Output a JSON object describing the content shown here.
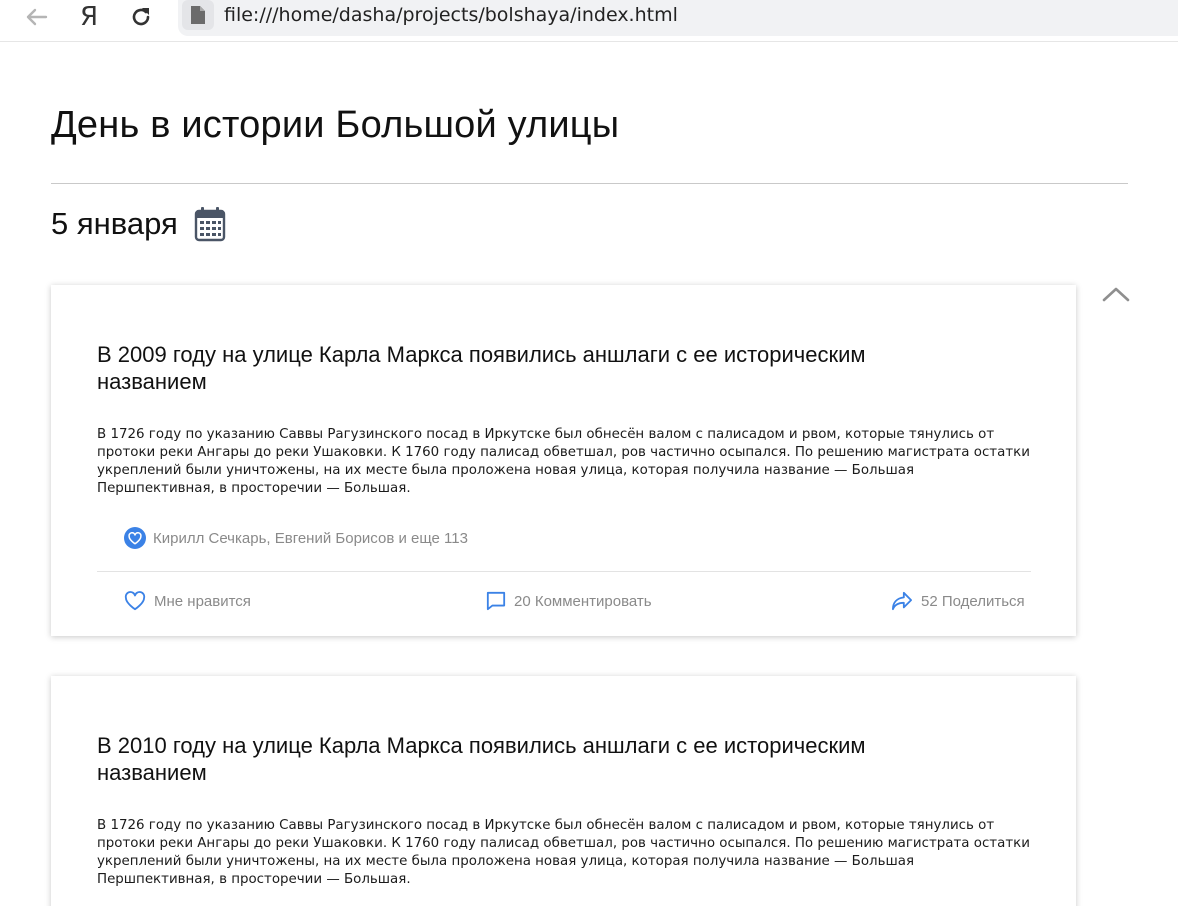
{
  "browser": {
    "back_icon": "arrow-left-icon",
    "yandex_logo": "Я",
    "reload_icon": "reload-icon",
    "file_icon": "file-icon",
    "url": "file:///home/dasha/projects/bolshaya/index.html"
  },
  "page": {
    "title": "День в истории Большой улицы",
    "date": "5 января",
    "calendar_icon": "calendar-icon",
    "collapse_icon": "chevron-up-icon"
  },
  "posts": [
    {
      "title": "В 2009 году на улице Карла Маркса появились аншлаги с ее историческим названием",
      "text": "В 1726 году по указанию Саввы Рагузинского посад в Иркутске был обнесён валом с палисадом и рвом, которые тянулись от протоки реки Ангары до реки Ушаковки. К 1760 году палисад обветшал, ров частично осыпался. По решению магистрата остатки укреплений были уничтожены, на их месте была проложена новая улица, которая получила название — Большая Першпективная, в просторечии — Большая.",
      "likers": "Кирилл Сечкарь, Евгений Борисов и еще 113",
      "like_label": "Мне нравится",
      "comment_label": "20 Комментировать",
      "share_label": "52 Поделиться"
    },
    {
      "title": "В 2010 году на улице Карла Маркса появились аншлаги с ее историческим названием",
      "text": "В 1726 году по указанию Саввы Рагузинского посад в Иркутске был обнесён валом с палисадом и рвом, которые тянулись от протоки реки Ангары до реки Ушаковки. К 1760 году палисад обветшал, ров частично осыпался. По решению магистрата остатки укреплений были уничтожены, на их месте была проложена новая улица, которая получила название — Большая Першпективная, в просторечии — Большая."
    }
  ],
  "colors": {
    "accent": "#3b82e6",
    "muted_text": "#8a8a8a"
  }
}
